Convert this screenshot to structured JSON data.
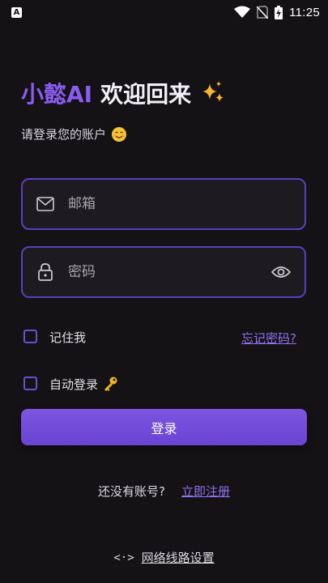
{
  "status_bar": {
    "notification_icon_glyph": "A",
    "time": "11:25"
  },
  "header": {
    "brand": "小懿AI",
    "welcome": "欢迎回来",
    "sparkle_icon": "sparkles-icon",
    "subtitle": "请登录您的账户",
    "subtitle_emoji": "smiling-face-icon"
  },
  "form": {
    "email_placeholder": "邮箱",
    "password_placeholder": "密码",
    "remember_me_label": "记住我",
    "forgot_password_label": "忘记密码?",
    "auto_login_label": "自动登录",
    "login_button_label": "登录"
  },
  "footer": {
    "no_account_text": "还没有账号?",
    "register_link": "立即注册",
    "network_icon_glyph": "<·>",
    "network_settings_label": "网络线路设置"
  },
  "colors": {
    "accent": "#8a5cf0",
    "border": "#5b3fbf",
    "background": "#141215"
  }
}
